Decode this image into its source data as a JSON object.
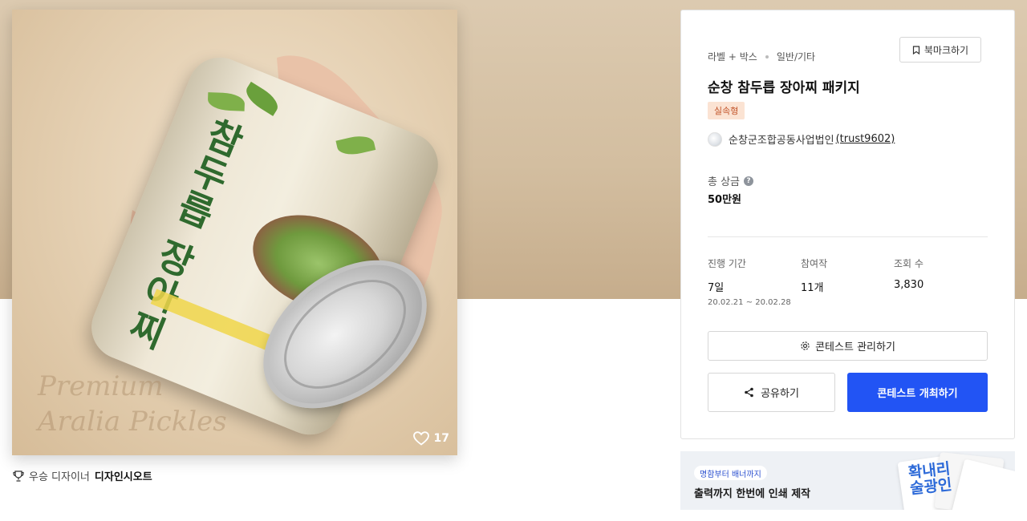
{
  "gallery": {
    "like_count": "17",
    "watermark_line1": "Premium",
    "watermark_line2": "Aralia Pickles",
    "can_title": "참두릅 장아찌"
  },
  "award": {
    "label": "우승 디자이너",
    "designer": "디자인시오트"
  },
  "contest": {
    "category": "라벨 + 박스",
    "subcategory": "일반/기타",
    "bookmark_label": "북마크하기",
    "title": "순창 참두릅 장아찌 패키지",
    "type_badge": "실속형",
    "host_name": "순창군조합공동사업법인",
    "host_id": "(trust9602)",
    "prize_label": "총 상금",
    "prize_value": "50만원",
    "stats": {
      "period_label": "진행 기간",
      "period_value": "7일",
      "period_range": "20.02.21 ~ 20.02.28",
      "entries_label": "참여작",
      "entries_value": "11개",
      "views_label": "조회 수",
      "views_value": "3,830"
    },
    "manage_label": "콘테스트 관리하기",
    "share_label": "공유하기",
    "host_contest_label": "콘테스트 개최하기"
  },
  "banner": {
    "pill": "명함부터 배너까지",
    "text": "출력까지 한번에 인쇄 제작",
    "art_text": "확내리 술광인"
  },
  "colors": {
    "primary_button": "#2254f4",
    "badge_bg": "#fbe3d3",
    "badge_text": "#c2542a"
  }
}
